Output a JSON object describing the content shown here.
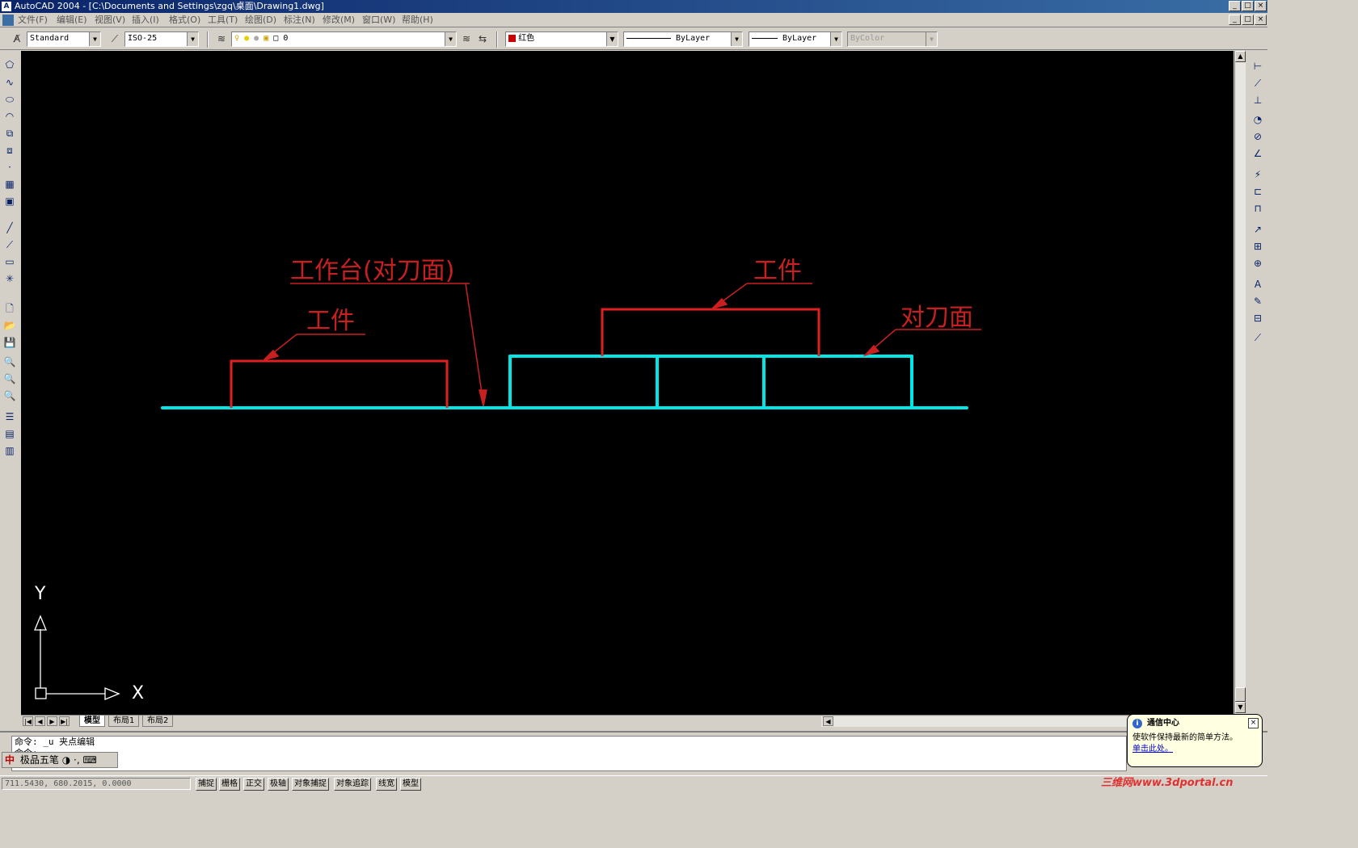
{
  "window": {
    "title": "AutoCAD 2004 - [C:\\Documents and Settings\\zgq\\桌面\\Drawing1.dwg]"
  },
  "menu": [
    "文件(F)",
    "编辑(E)",
    "视图(V)",
    "插入(I)",
    "格式(O)",
    "工具(T)",
    "绘图(D)",
    "标注(N)",
    "修改(M)",
    "窗口(W)",
    "帮助(H)"
  ],
  "toolbar": {
    "text_style": "Standard",
    "dim_style": "ISO-25",
    "layer": "0",
    "color": "红色",
    "color_swatch": "#cc0000",
    "linetype": "ByLayer",
    "lineweight": "ByLayer",
    "plotstyle": "ByColor"
  },
  "drawing": {
    "background": "#000000",
    "label_color": "#c82020",
    "line_color_cyan": "#00e5e5",
    "labels": {
      "table": "工作台(对刀面)",
      "workpiece_left": "工件",
      "workpiece_right": "工件",
      "reference_face": "对刀面"
    },
    "ucs": {
      "x": "X",
      "y": "Y"
    }
  },
  "layout_tabs": [
    "模型",
    "布局1",
    "布局2"
  ],
  "command": {
    "line1": "命令: _u 夹点编辑",
    "line2": "命令:"
  },
  "ime": {
    "mode": "中",
    "name": "极品五笔"
  },
  "status": {
    "coords": "711.5430, 680.2015, 0.0000",
    "buttons": [
      "捕捉",
      "栅格",
      "正交",
      "极轴",
      "对象捕捉",
      "对象追踪",
      "线宽",
      "模型"
    ]
  },
  "notification": {
    "title": "通信中心",
    "body": "使软件保持最新的简单方法。",
    "link": "单击此处。"
  },
  "watermark": "三维网www.3dportal.cn"
}
